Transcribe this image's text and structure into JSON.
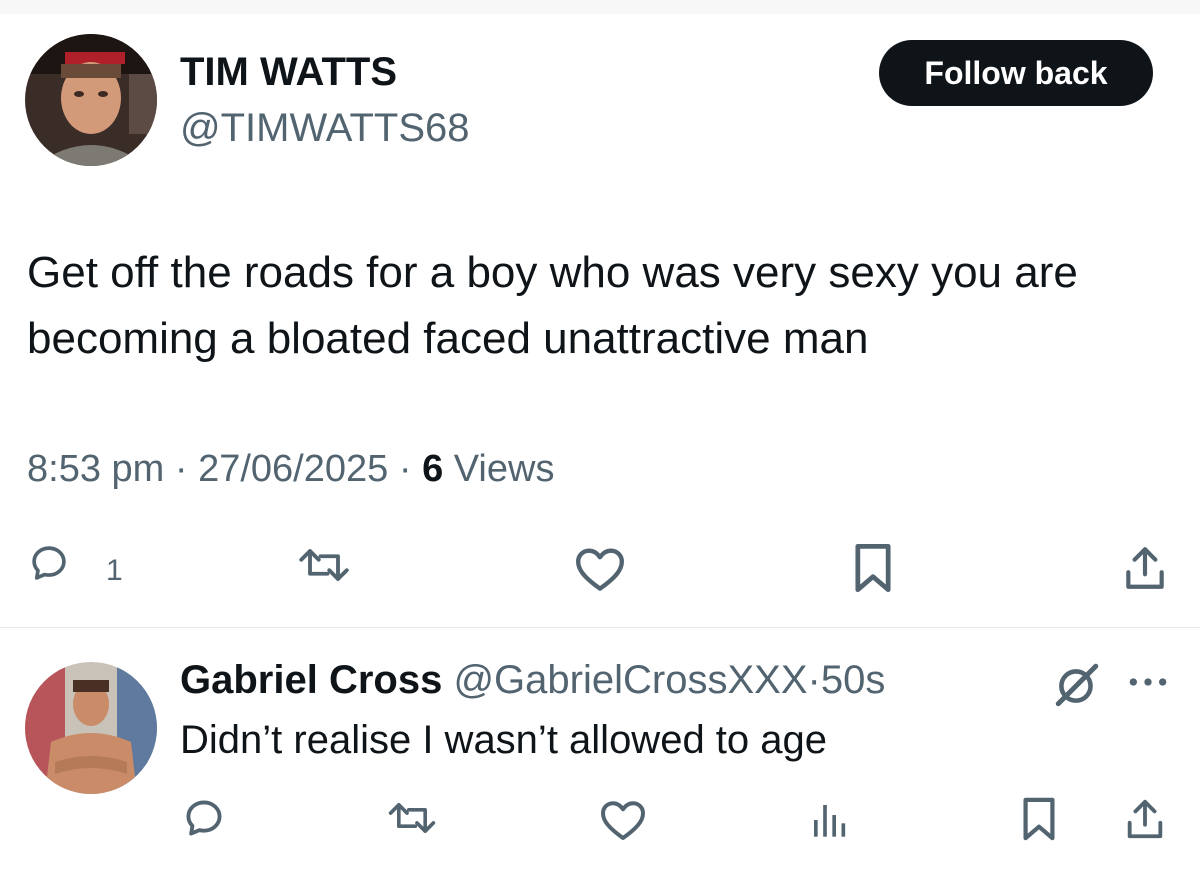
{
  "tweet": {
    "author_name": "TIM WATTS",
    "author_handle": "@TIMWATTS68",
    "follow_label": "Follow back",
    "text": "Get off the roads for a boy who was very sexy you are becoming a bloated faced unattractive man",
    "time": "8:53 pm",
    "date": "27/06/2025",
    "views_count": "6",
    "views_label": "Views",
    "separator": "·",
    "actions": {
      "reply_icon": "reply-bubble-icon",
      "reply_count": "1",
      "retweet_icon": "retweet-icon",
      "like_icon": "heart-icon",
      "bookmark_icon": "bookmark-icon",
      "share_icon": "share-upload-icon"
    }
  },
  "reply": {
    "author_name": "Gabriel Cross",
    "author_handle": "@GabrielCrossXXX",
    "separator": "·",
    "age": "50s",
    "text": "Didn’t realise I wasn’t allowed to age",
    "actions": {
      "grok_icon": "grok-icon",
      "more_icon": "more-dots-icon",
      "reply_icon": "reply-bubble-icon",
      "retweet_icon": "retweet-icon",
      "like_icon": "heart-icon",
      "views_icon": "analytics-bars-icon",
      "bookmark_icon": "bookmark-icon",
      "share_icon": "share-upload-icon"
    }
  },
  "colors": {
    "text_primary": "#0f1419",
    "text_secondary": "#536471",
    "button_bg": "#0f1419",
    "divider": "#e6e9ec"
  }
}
